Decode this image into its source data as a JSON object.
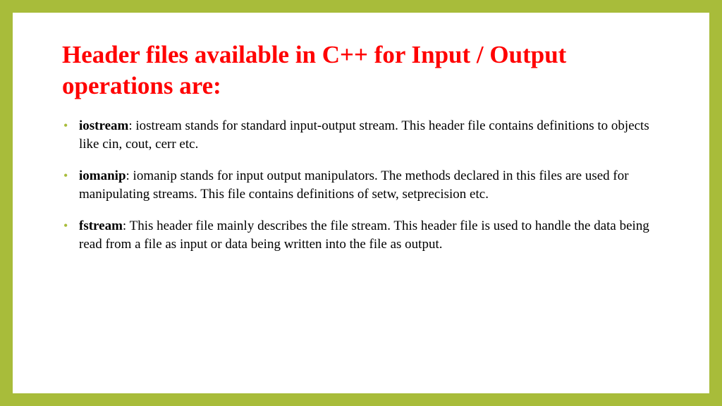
{
  "slide": {
    "title": "Header files available in C++ for Input / Output operations are:",
    "bullets": [
      {
        "term": "iostream",
        "description": ": iostream stands for standard input-output stream. This header file contains definitions to objects like cin, cout, cerr etc."
      },
      {
        "term": "iomanip",
        "description": ": iomanip stands for input output manipulators. The methods declared in this files are used for manipulating streams. This file contains definitions of setw, setprecision etc."
      },
      {
        "term": "fstream",
        "description": ": This header file mainly describes the file stream. This header file is used to handle the data being read from a file as input or data being written into the file as output."
      }
    ]
  }
}
